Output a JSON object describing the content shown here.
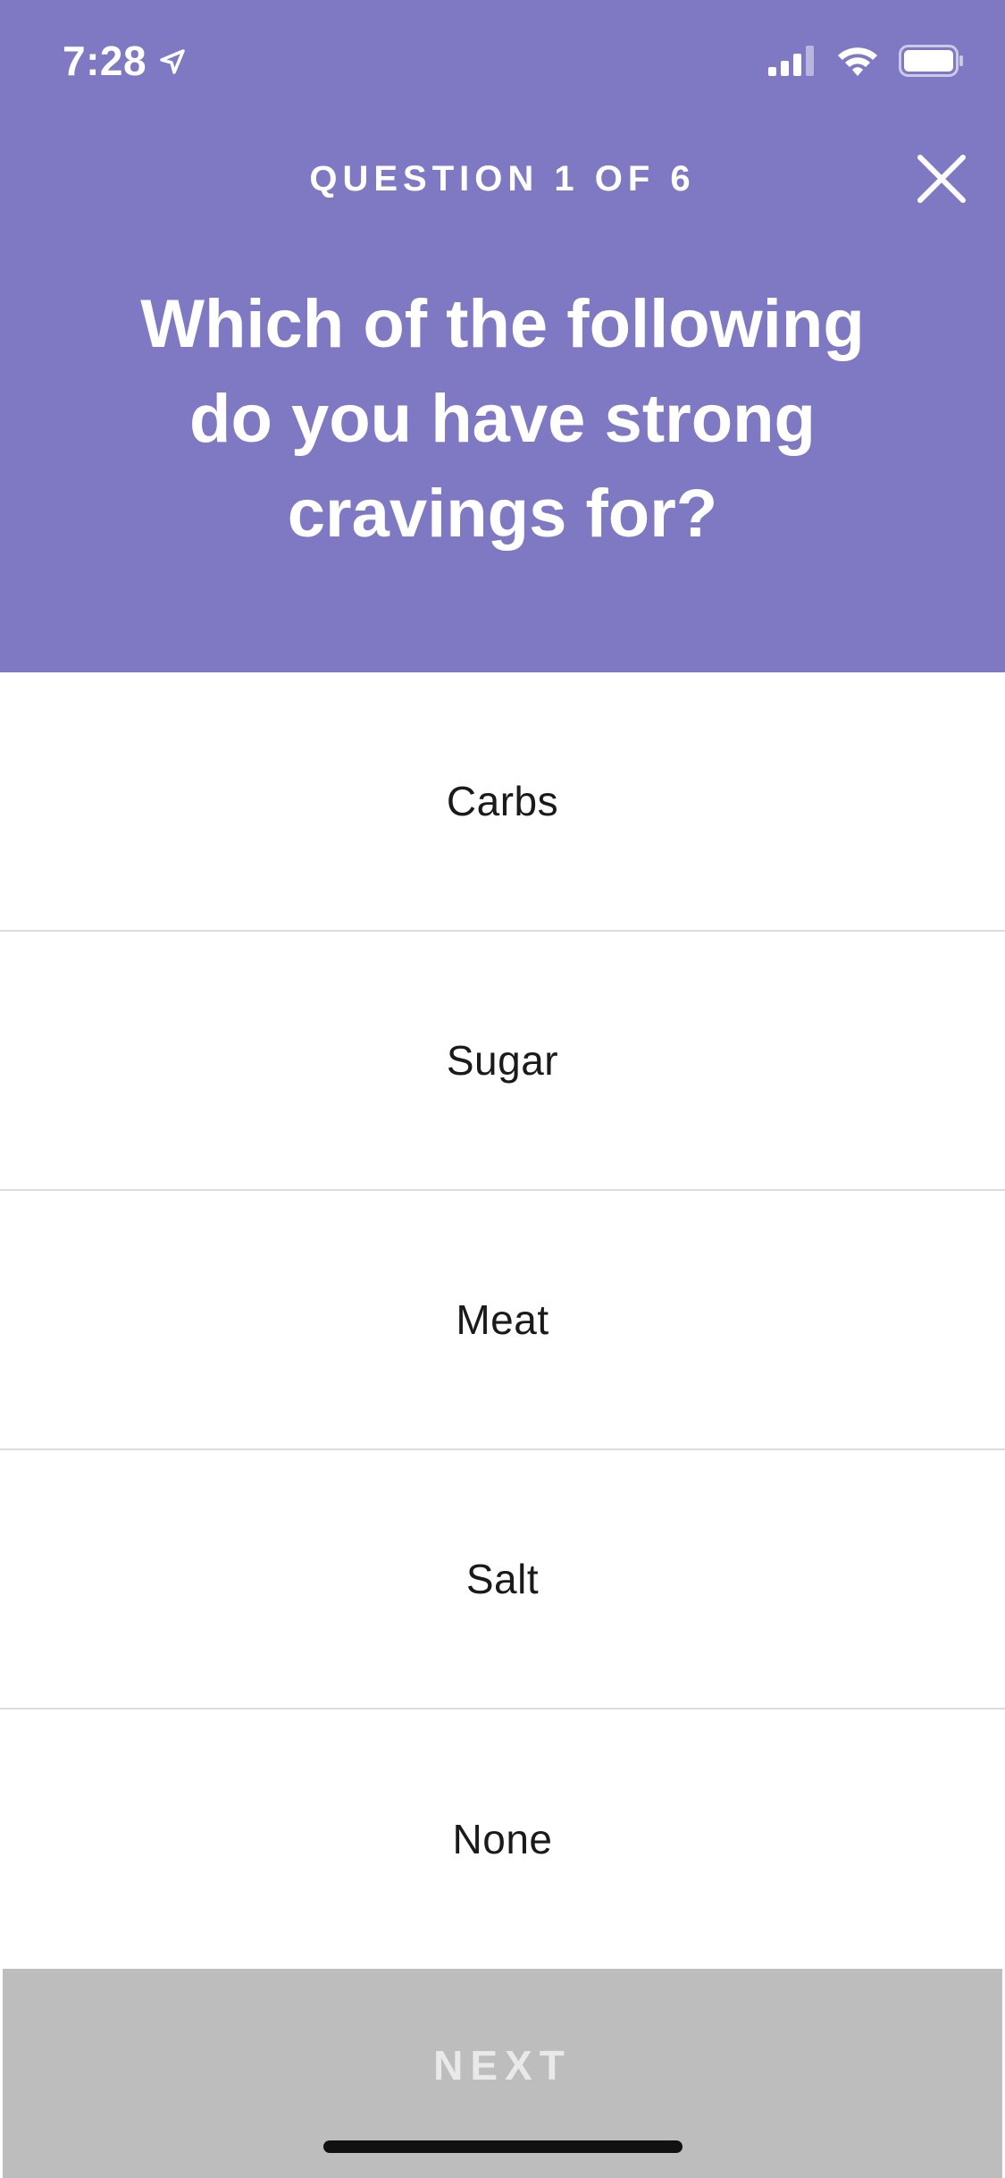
{
  "status_bar": {
    "time": "7:28",
    "icons": [
      "location-arrow-icon",
      "cellular-signal-icon",
      "wifi-icon",
      "battery-icon"
    ]
  },
  "header": {
    "progress_label": "QUESTION 1 OF 6",
    "question": "Which of the following do you have strong cravings for?",
    "background_color": "#7f79c3",
    "close_icon": "close-icon"
  },
  "options": [
    {
      "label": "Carbs"
    },
    {
      "label": "Sugar"
    },
    {
      "label": "Meat"
    },
    {
      "label": "Salt"
    },
    {
      "label": "None"
    }
  ],
  "footer": {
    "next_label": "NEXT",
    "next_disabled": true,
    "next_color": "#bdbdbd"
  }
}
